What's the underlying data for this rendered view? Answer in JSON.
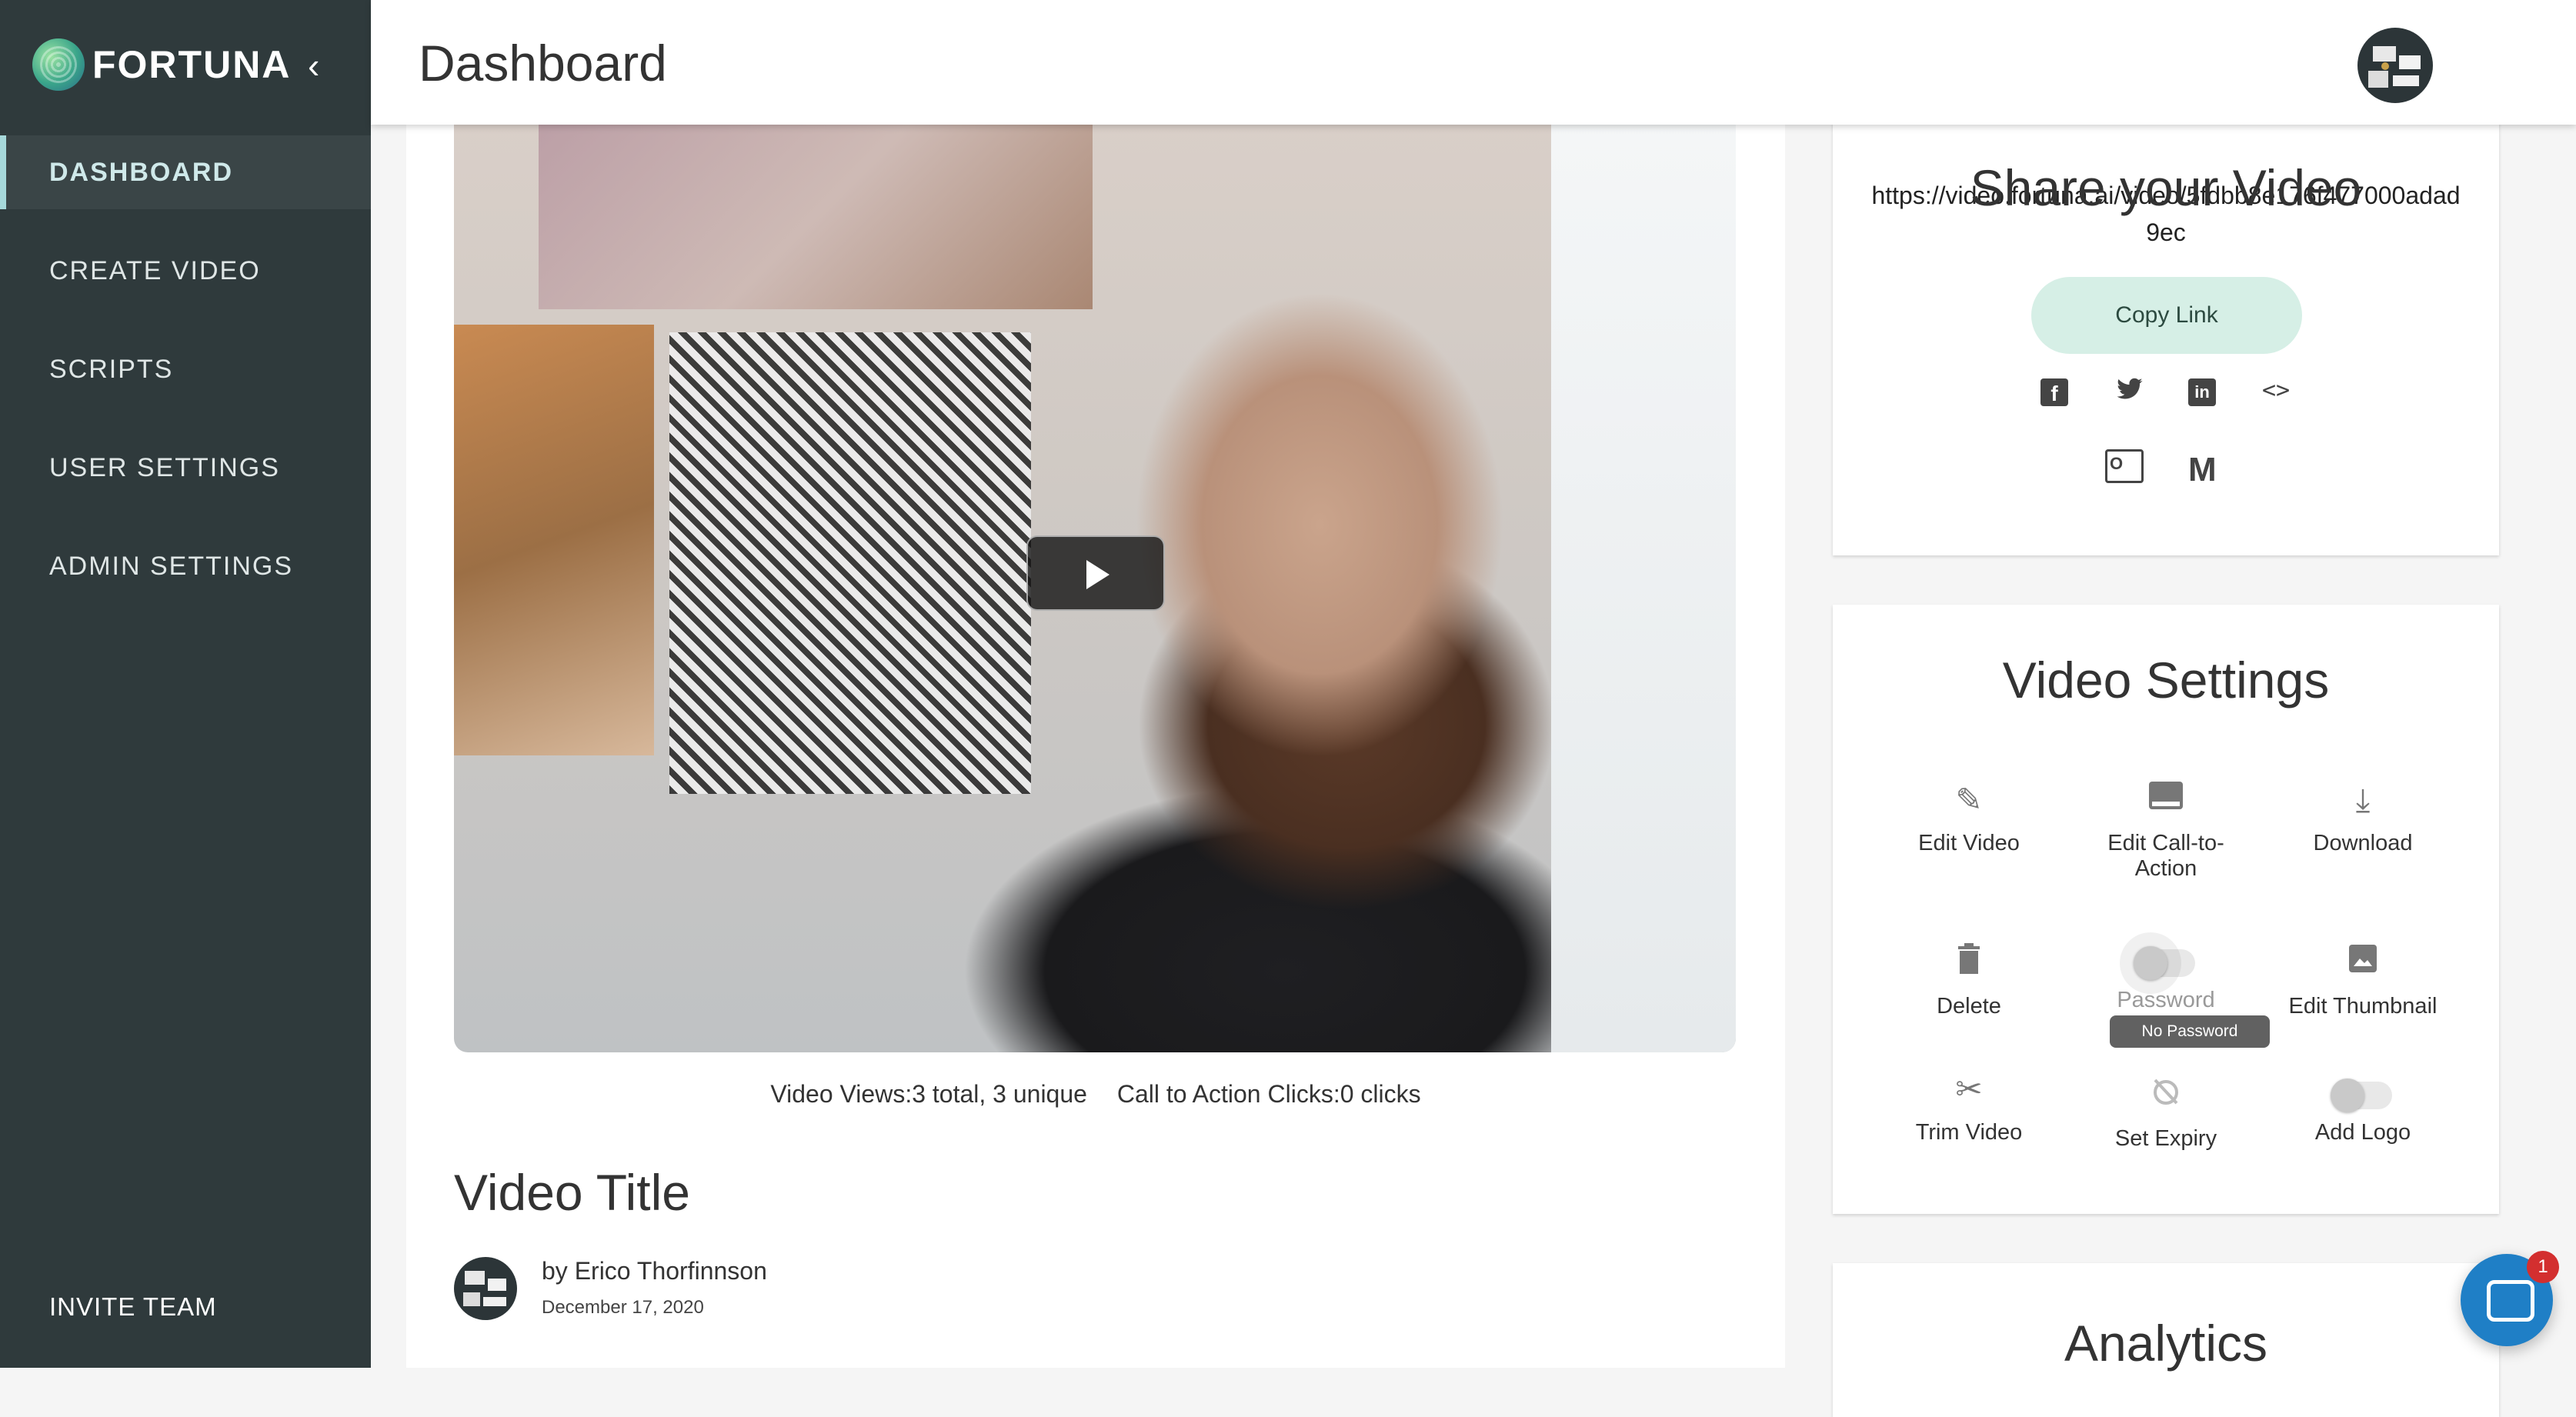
{
  "app": {
    "brand": "FORTUNA"
  },
  "sidebar": {
    "items": [
      {
        "label": "DASHBOARD"
      },
      {
        "label": "CREATE VIDEO"
      },
      {
        "label": "SCRIPTS"
      },
      {
        "label": "USER SETTINGS"
      },
      {
        "label": "ADMIN SETTINGS"
      }
    ],
    "invite": "INVITE TEAM"
  },
  "header": {
    "title": "Dashboard"
  },
  "video": {
    "stats_views": "Video Views:3 total, 3 unique",
    "stats_clicks": "Call to Action Clicks:0 clicks",
    "title": "Video Title",
    "author": "by Erico Thorfinnson",
    "date": "December 17, 2020"
  },
  "share": {
    "heading": "Share your Video",
    "url": "https://video.fortuna.ai/video/5fdbb8e176f477000adad9ec",
    "copy_label": "Copy Link",
    "icons": [
      "facebook-icon",
      "twitter-icon",
      "linkedin-icon",
      "embed-code-icon",
      "outlook-icon",
      "gmail-icon"
    ]
  },
  "settings": {
    "heading": "Video Settings",
    "items": [
      {
        "label": "Edit Video",
        "icon": "pencil-icon"
      },
      {
        "label": "Edit Call-to-Action",
        "icon": "call-to-action-icon"
      },
      {
        "label": "Download",
        "icon": "download-icon"
      },
      {
        "label": "Delete",
        "icon": "trash-icon"
      },
      {
        "label": "Password",
        "icon": "toggle"
      },
      {
        "label": "Edit Thumbnail",
        "icon": "image-icon"
      },
      {
        "label": "Trim Video",
        "icon": "scissors-icon"
      },
      {
        "label": "Set Expiry",
        "icon": "alarm-off-icon"
      },
      {
        "label": "Add Logo",
        "icon": "toggle"
      }
    ],
    "tooltip": "No Password"
  },
  "analytics": {
    "heading": "Analytics"
  },
  "chat": {
    "badge": "1"
  }
}
